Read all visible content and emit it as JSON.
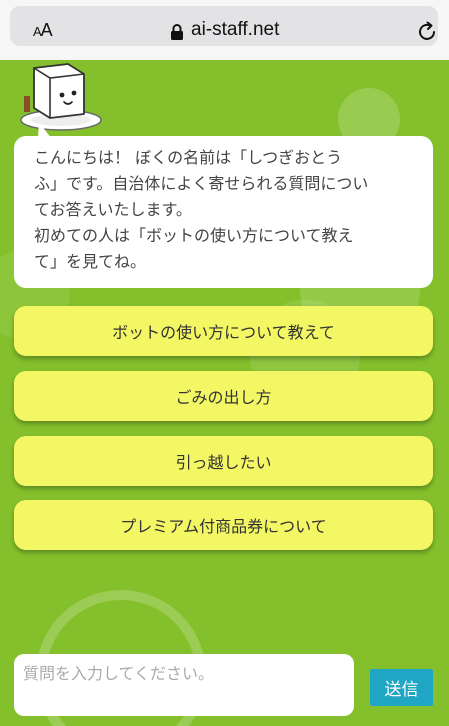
{
  "browser": {
    "text_size_label": "AA",
    "url": "ai-staff.net"
  },
  "chat": {
    "bot_greeting": "こんにちは！ ぼくの名前は「しつぎおとう\nふ」です。自治体によく寄せられる質問につい\nてお答えいたします。\n初めての人は「ボットの使い方について教え\nて」を見てね。",
    "options": [
      {
        "label": "ボットの使い方について教えて"
      },
      {
        "label": "ごみの出し方"
      },
      {
        "label": "引っ越したい"
      },
      {
        "label": "プレミアム付商品券について"
      }
    ]
  },
  "composer": {
    "placeholder": "質問を入力してください。",
    "send_label": "送信"
  },
  "colors": {
    "background_green": "#84c02b",
    "option_yellow": "#f2f763",
    "send_button": "#1fa6c4"
  }
}
